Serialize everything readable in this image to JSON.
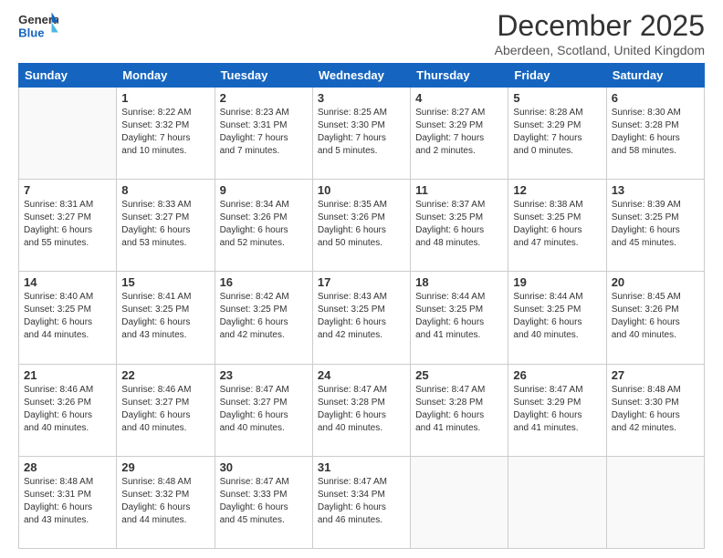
{
  "logo": {
    "line1": "General",
    "line2": "Blue"
  },
  "title": "December 2025",
  "subtitle": "Aberdeen, Scotland, United Kingdom",
  "days_of_week": [
    "Sunday",
    "Monday",
    "Tuesday",
    "Wednesday",
    "Thursday",
    "Friday",
    "Saturday"
  ],
  "weeks": [
    [
      {
        "day": "",
        "info": ""
      },
      {
        "day": "1",
        "info": "Sunrise: 8:22 AM\nSunset: 3:32 PM\nDaylight: 7 hours\nand 10 minutes."
      },
      {
        "day": "2",
        "info": "Sunrise: 8:23 AM\nSunset: 3:31 PM\nDaylight: 7 hours\nand 7 minutes."
      },
      {
        "day": "3",
        "info": "Sunrise: 8:25 AM\nSunset: 3:30 PM\nDaylight: 7 hours\nand 5 minutes."
      },
      {
        "day": "4",
        "info": "Sunrise: 8:27 AM\nSunset: 3:29 PM\nDaylight: 7 hours\nand 2 minutes."
      },
      {
        "day": "5",
        "info": "Sunrise: 8:28 AM\nSunset: 3:29 PM\nDaylight: 7 hours\nand 0 minutes."
      },
      {
        "day": "6",
        "info": "Sunrise: 8:30 AM\nSunset: 3:28 PM\nDaylight: 6 hours\nand 58 minutes."
      }
    ],
    [
      {
        "day": "7",
        "info": "Sunrise: 8:31 AM\nSunset: 3:27 PM\nDaylight: 6 hours\nand 55 minutes."
      },
      {
        "day": "8",
        "info": "Sunrise: 8:33 AM\nSunset: 3:27 PM\nDaylight: 6 hours\nand 53 minutes."
      },
      {
        "day": "9",
        "info": "Sunrise: 8:34 AM\nSunset: 3:26 PM\nDaylight: 6 hours\nand 52 minutes."
      },
      {
        "day": "10",
        "info": "Sunrise: 8:35 AM\nSunset: 3:26 PM\nDaylight: 6 hours\nand 50 minutes."
      },
      {
        "day": "11",
        "info": "Sunrise: 8:37 AM\nSunset: 3:25 PM\nDaylight: 6 hours\nand 48 minutes."
      },
      {
        "day": "12",
        "info": "Sunrise: 8:38 AM\nSunset: 3:25 PM\nDaylight: 6 hours\nand 47 minutes."
      },
      {
        "day": "13",
        "info": "Sunrise: 8:39 AM\nSunset: 3:25 PM\nDaylight: 6 hours\nand 45 minutes."
      }
    ],
    [
      {
        "day": "14",
        "info": "Sunrise: 8:40 AM\nSunset: 3:25 PM\nDaylight: 6 hours\nand 44 minutes."
      },
      {
        "day": "15",
        "info": "Sunrise: 8:41 AM\nSunset: 3:25 PM\nDaylight: 6 hours\nand 43 minutes."
      },
      {
        "day": "16",
        "info": "Sunrise: 8:42 AM\nSunset: 3:25 PM\nDaylight: 6 hours\nand 42 minutes."
      },
      {
        "day": "17",
        "info": "Sunrise: 8:43 AM\nSunset: 3:25 PM\nDaylight: 6 hours\nand 42 minutes."
      },
      {
        "day": "18",
        "info": "Sunrise: 8:44 AM\nSunset: 3:25 PM\nDaylight: 6 hours\nand 41 minutes."
      },
      {
        "day": "19",
        "info": "Sunrise: 8:44 AM\nSunset: 3:25 PM\nDaylight: 6 hours\nand 40 minutes."
      },
      {
        "day": "20",
        "info": "Sunrise: 8:45 AM\nSunset: 3:26 PM\nDaylight: 6 hours\nand 40 minutes."
      }
    ],
    [
      {
        "day": "21",
        "info": "Sunrise: 8:46 AM\nSunset: 3:26 PM\nDaylight: 6 hours\nand 40 minutes."
      },
      {
        "day": "22",
        "info": "Sunrise: 8:46 AM\nSunset: 3:27 PM\nDaylight: 6 hours\nand 40 minutes."
      },
      {
        "day": "23",
        "info": "Sunrise: 8:47 AM\nSunset: 3:27 PM\nDaylight: 6 hours\nand 40 minutes."
      },
      {
        "day": "24",
        "info": "Sunrise: 8:47 AM\nSunset: 3:28 PM\nDaylight: 6 hours\nand 40 minutes."
      },
      {
        "day": "25",
        "info": "Sunrise: 8:47 AM\nSunset: 3:28 PM\nDaylight: 6 hours\nand 41 minutes."
      },
      {
        "day": "26",
        "info": "Sunrise: 8:47 AM\nSunset: 3:29 PM\nDaylight: 6 hours\nand 41 minutes."
      },
      {
        "day": "27",
        "info": "Sunrise: 8:48 AM\nSunset: 3:30 PM\nDaylight: 6 hours\nand 42 minutes."
      }
    ],
    [
      {
        "day": "28",
        "info": "Sunrise: 8:48 AM\nSunset: 3:31 PM\nDaylight: 6 hours\nand 43 minutes."
      },
      {
        "day": "29",
        "info": "Sunrise: 8:48 AM\nSunset: 3:32 PM\nDaylight: 6 hours\nand 44 minutes."
      },
      {
        "day": "30",
        "info": "Sunrise: 8:47 AM\nSunset: 3:33 PM\nDaylight: 6 hours\nand 45 minutes."
      },
      {
        "day": "31",
        "info": "Sunrise: 8:47 AM\nSunset: 3:34 PM\nDaylight: 6 hours\nand 46 minutes."
      },
      {
        "day": "",
        "info": ""
      },
      {
        "day": "",
        "info": ""
      },
      {
        "day": "",
        "info": ""
      }
    ]
  ]
}
